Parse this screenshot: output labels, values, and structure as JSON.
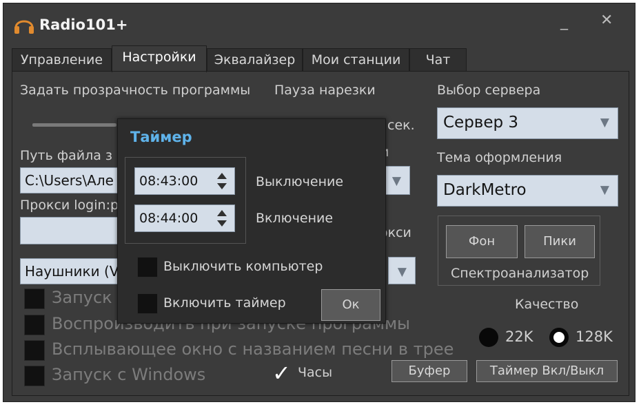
{
  "window": {
    "title": "Radio101+",
    "minimize": "_",
    "close": "✕"
  },
  "tabs": [
    {
      "label": "Управление"
    },
    {
      "label": "Настройки"
    },
    {
      "label": "Эквалайзер"
    },
    {
      "label": "Мои станции"
    },
    {
      "label": "Чат"
    }
  ],
  "settings": {
    "transparency_label": "Задать прозрачность программы",
    "pause_label": "Пауза нарезки",
    "seconds_suffix": "сек.",
    "path_label": "Путь файла з",
    "path_value": "C:\\Users\\Але",
    "right_fragment_label": "и",
    "proxy_label": "Прокси login:p",
    "proxy_value": "",
    "proxy_right_label": "окси",
    "audio_device_value": "Наушники (V",
    "checkbox_autostart_label": "Запуск",
    "checkbox_play_label": "Воспроизводить при запуске программы",
    "checkbox_popup_label": "Всплывающее окно с названием песни в трее",
    "checkbox_windows_label": "Запуск с Windows",
    "clock_label": "Часы",
    "clock_check": "✓",
    "buffer_button": "Буфер",
    "timer_button": "Таймер Вкл/Выкл"
  },
  "server": {
    "label": "Выбор сервера",
    "value": "Сервер 3"
  },
  "theme": {
    "label": "Тема оформления",
    "value": "DarkMetro"
  },
  "spectrum": {
    "background_button": "Фон",
    "peaks_button": "Пики",
    "label": "Спектроанализатор"
  },
  "quality": {
    "label": "Качество",
    "option_22": "22K",
    "option_128": "128K",
    "selected": "128K"
  },
  "timer_dialog": {
    "title": "Таймер",
    "off_time": "08:43:00",
    "off_label": "Выключение",
    "on_time": "08:44:00",
    "on_label": "Включение",
    "shutdown_label": "Выключить компьютер",
    "enable_label": "Включить таймер",
    "ok_button": "Ок"
  },
  "colors": {
    "window_bg": "#3b3b3b",
    "dialog_bg": "#2c2c2c",
    "accent_title": "#5fb3ea",
    "field_bg": "#d4dde8"
  },
  "icons": {
    "app": "headphones-icon",
    "dropdown": "chevron-down-icon",
    "spin": "spin-arrows-icon"
  }
}
